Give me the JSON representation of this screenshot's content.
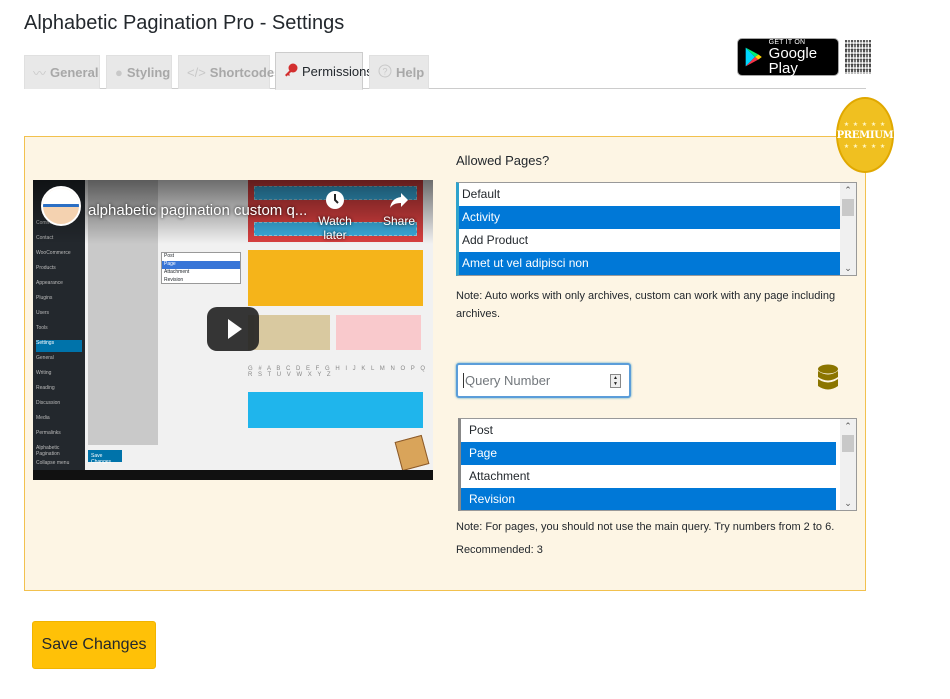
{
  "header": {
    "title": "Alphabetic Pagination Pro - Settings"
  },
  "tabs": [
    {
      "label": "General",
      "icon": "wave-icon",
      "glyph": "〰",
      "active": false
    },
    {
      "label": "Styling",
      "icon": "palette-icon",
      "glyph": "●",
      "active": false
    },
    {
      "label": "Shortcodes",
      "icon": "code-icon",
      "glyph": "</>",
      "active": false
    },
    {
      "label": "Permissions",
      "icon": "key-icon",
      "glyph": "🔑",
      "active": true
    },
    {
      "label": "Help",
      "icon": "question-circle-icon",
      "glyph": "?",
      "active": false
    }
  ],
  "google_play": {
    "small": "GET IT ON",
    "big": "Google Play"
  },
  "premium_badge": {
    "stars": "★ ★ ★ ★ ★",
    "label": "PREMIUM"
  },
  "video": {
    "title": "alphabetic pagination custom q...",
    "watch_later": "Watch later",
    "share": "Share",
    "letters": "G # A B C D E F G H I J K L M N O P Q R S T U V W X Y Z",
    "sidebar_items": [
      "Comments",
      "Contact",
      "WooCommerce",
      "Products",
      "Appearance",
      "Plugins",
      "Users",
      "Tools",
      "Settings",
      "General",
      "Writing",
      "Reading",
      "Discussion",
      "Media",
      "Permalinks",
      "Alphabetic Pagination",
      "Collapse menu"
    ],
    "mini_list": [
      "Post",
      "Page",
      "Attachment",
      "Revision"
    ],
    "mini_save": "Save Changes"
  },
  "allowed_pages": {
    "label": "Allowed Pages?",
    "options": [
      {
        "text": "Default",
        "selected": false
      },
      {
        "text": "Activity",
        "selected": true
      },
      {
        "text": "Add Product",
        "selected": false
      },
      {
        "text": "Amet ut vel adipisci non",
        "selected": true
      }
    ],
    "note": "Note: Auto works with only archives, custom can work with any page including archives."
  },
  "query": {
    "placeholder": "Query Number",
    "post_types": [
      {
        "text": "Post",
        "selected": false
      },
      {
        "text": "Page",
        "selected": true
      },
      {
        "text": "Attachment",
        "selected": false
      },
      {
        "text": "Revision",
        "selected": true
      }
    ],
    "note": "Note: For pages, you should not use the main query. Try numbers from 2 to 6.",
    "recommended": "Recommended: 3"
  },
  "colors": {
    "accent": "#ffc107",
    "selection": "#0078d7",
    "panel_bg": "#fdf5e4",
    "panel_border": "#f2c14e",
    "db_icon": "#8b7500"
  },
  "actions": {
    "save_label": "Save Changes"
  }
}
